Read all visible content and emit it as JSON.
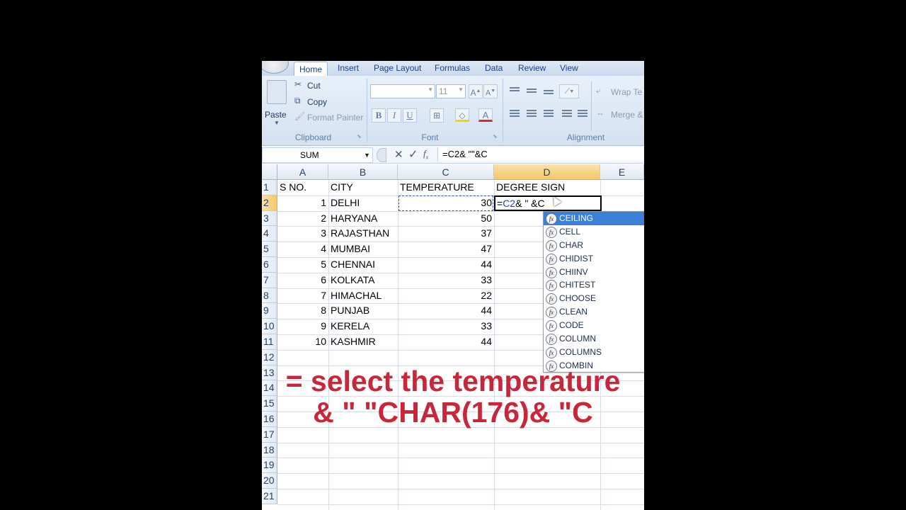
{
  "tabs": [
    "Home",
    "Insert",
    "Page Layout",
    "Formulas",
    "Data",
    "Review",
    "View"
  ],
  "ribbon": {
    "clipboard": {
      "paste": "Paste",
      "cut": "Cut",
      "copy": "Copy",
      "format_painter": "Format Painter",
      "label": "Clipboard"
    },
    "font": {
      "size": "11",
      "bold": "B",
      "italic": "I",
      "underline": "U",
      "label": "Font"
    },
    "alignment": {
      "wrap_text": "Wrap Te",
      "merge": "Merge &",
      "label": "Alignment"
    }
  },
  "formula_bar": {
    "name_box": "SUM",
    "formula": "=C2& \"\"&C"
  },
  "columns": [
    "A",
    "B",
    "C",
    "D",
    "E"
  ],
  "rows": [
    "1",
    "2",
    "3",
    "4",
    "5",
    "6",
    "7",
    "8",
    "9",
    "10",
    "11",
    "12",
    "13",
    "14",
    "15",
    "16",
    "17",
    "18",
    "19",
    "20",
    "21"
  ],
  "header_row": {
    "a": "S NO.",
    "b": "CITY",
    "c": "TEMPERATURE",
    "d": "DEGREE SIGN"
  },
  "data_rows": [
    {
      "sno": "1",
      "city": "DELHI",
      "temp": "30"
    },
    {
      "sno": "2",
      "city": "HARYANA",
      "temp": "50"
    },
    {
      "sno": "3",
      "city": "RAJASTHAN",
      "temp": "37"
    },
    {
      "sno": "4",
      "city": "MUMBAI",
      "temp": "47"
    },
    {
      "sno": "5",
      "city": "CHENNAI",
      "temp": "44"
    },
    {
      "sno": "6",
      "city": "KOLKATA",
      "temp": "33"
    },
    {
      "sno": "7",
      "city": "HIMACHAL",
      "temp": "22"
    },
    {
      "sno": "8",
      "city": "PUNJAB",
      "temp": "44"
    },
    {
      "sno": "9",
      "city": "KERELA",
      "temp": "33"
    },
    {
      "sno": "10",
      "city": "KASHMIR",
      "temp": "44"
    }
  ],
  "edit_cell": {
    "prefix": "=",
    "ref": "C2",
    "rest": "& \" &C"
  },
  "autocomplete": [
    "CEILING",
    "CELL",
    "CHAR",
    "CHIDIST",
    "CHIINV",
    "CHITEST",
    "CHOOSE",
    "CLEAN",
    "CODE",
    "COLUMN",
    "COLUMNS",
    "COMBIN"
  ],
  "caption": {
    "line1": "= select the temperature",
    "line2": "& \" \"CHAR(176)& \"C"
  },
  "colors": {
    "caption": "#c8273b",
    "selection": "#3b7fd6"
  }
}
